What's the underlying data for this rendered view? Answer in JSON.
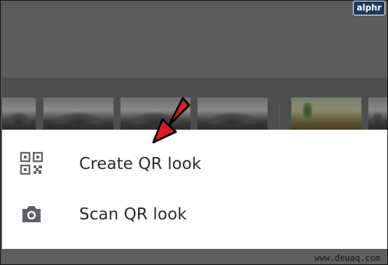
{
  "branding": {
    "badge_text": "alphr",
    "watermark_text": "www.deuaq.com"
  },
  "menu": {
    "items": [
      {
        "label": "Create QR look",
        "icon": "qr-code-icon"
      },
      {
        "label": "Scan QR look",
        "icon": "camera-icon"
      }
    ]
  },
  "colors": {
    "background_green": "#3f7149",
    "dim_overlay": "#5d5d5d",
    "sheet": "#ffffff",
    "text": "#2a2a2a",
    "icon": "#5f6368",
    "arrow_fill": "#e11b1b",
    "arrow_stroke": "#000000",
    "badge_bg": "#1e3a5f"
  },
  "annotation": {
    "arrow_icon": "red-pointer-arrow"
  }
}
